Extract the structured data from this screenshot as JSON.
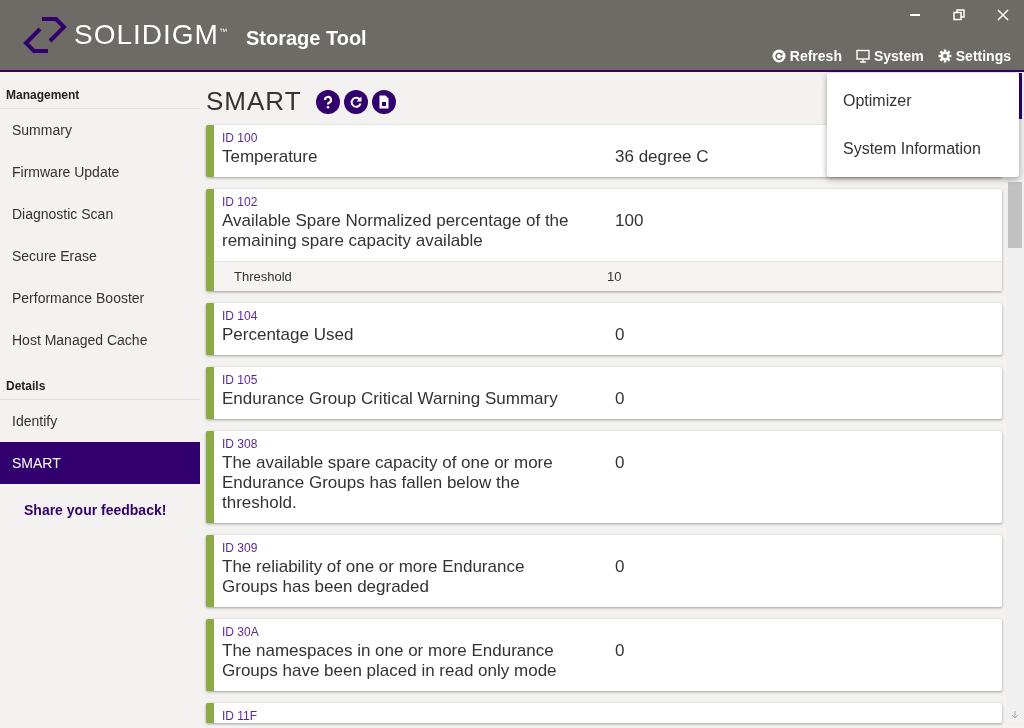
{
  "header": {
    "brand": "SOLIDIGM$^{™}$",
    "app_title": "Storage Tool",
    "actions": [
      {
        "kind": "refresh",
        "label": "Refresh"
      },
      {
        "kind": "system",
        "label": "System"
      },
      {
        "kind": "settings",
        "label": "Settings"
      }
    ]
  },
  "sidebar": {
    "sections": [
      {
        "title": "Management",
        "items": [
          {
            "label": "Summary",
            "selected": false
          },
          {
            "label": "Firmware Update",
            "selected": false
          },
          {
            "label": "Diagnostic Scan",
            "selected": false
          },
          {
            "label": "Secure Erase",
            "selected": false
          },
          {
            "label": "Performance Booster",
            "selected": false
          },
          {
            "label": "Host Managed Cache",
            "selected": false
          }
        ]
      },
      {
        "title": "Details",
        "items": [
          {
            "label": "Identify",
            "selected": false
          },
          {
            "label": "SMART",
            "selected": true
          }
        ]
      }
    ],
    "feedback_link": "Share your feedback!"
  },
  "page": {
    "title": "SMART",
    "tools": [
      {
        "kind": "help"
      },
      {
        "kind": "refresh"
      },
      {
        "kind": "export"
      }
    ]
  },
  "attributes": [
    {
      "id": "ID 100",
      "name": "Temperature",
      "value": "36 degree C"
    },
    {
      "id": "ID 102",
      "name": "Available Spare Normalized percentage of the remaining spare capacity available",
      "value": "100",
      "sub_rows": [
        {
          "name": "Threshold",
          "value": "10"
        }
      ]
    },
    {
      "id": "ID 104",
      "name": "Percentage Used",
      "value": "0"
    },
    {
      "id": "ID 105",
      "name": "Endurance Group Critical Warning Summary",
      "value": "0"
    },
    {
      "id": "ID 308",
      "name": "The available spare capacity of one or more Endurance Groups has fallen below the threshold.",
      "value": "0"
    },
    {
      "id": "ID 309",
      "name": "The reliability of one or more Endurance Groups has been degraded",
      "value": "0"
    },
    {
      "id": "ID 30A",
      "name": "The namespaces in one or more Endurance Groups have been placed in read only mode",
      "value": "0"
    },
    {
      "id": "ID 11F"
    }
  ],
  "settings_menu": {
    "items": [
      "Optimizer",
      "System Information"
    ]
  }
}
